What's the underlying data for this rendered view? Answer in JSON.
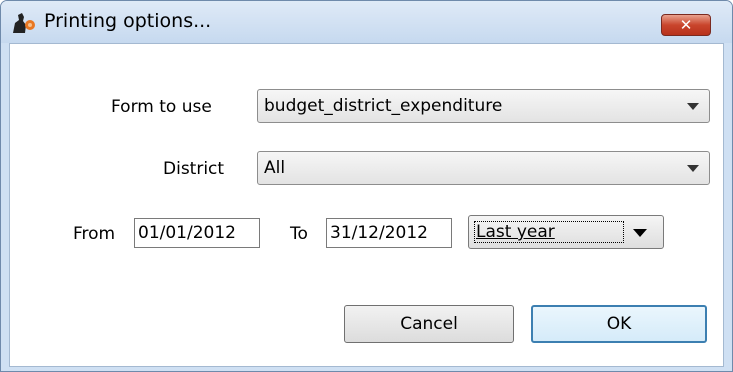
{
  "window": {
    "title": "Printing options...",
    "close_glyph": "✕"
  },
  "form": {
    "form_label": "Form to use",
    "form_value": "budget_district_expenditure",
    "district_label": "District",
    "district_value": "All",
    "from_label": "From",
    "from_value": "01/01/2012",
    "to_label": "To",
    "to_value": "31/12/2012",
    "period_value": "Last year"
  },
  "buttons": {
    "cancel_label": "Cancel",
    "ok_label": "OK"
  },
  "icons": {
    "app": "app-logo-icon",
    "close": "close-icon",
    "dropdown": "chevron-down-icon"
  },
  "colors": {
    "title_bar": "#c6d9ef",
    "close_button": "#c9452c",
    "default_button_border": "#3c7fb1"
  }
}
